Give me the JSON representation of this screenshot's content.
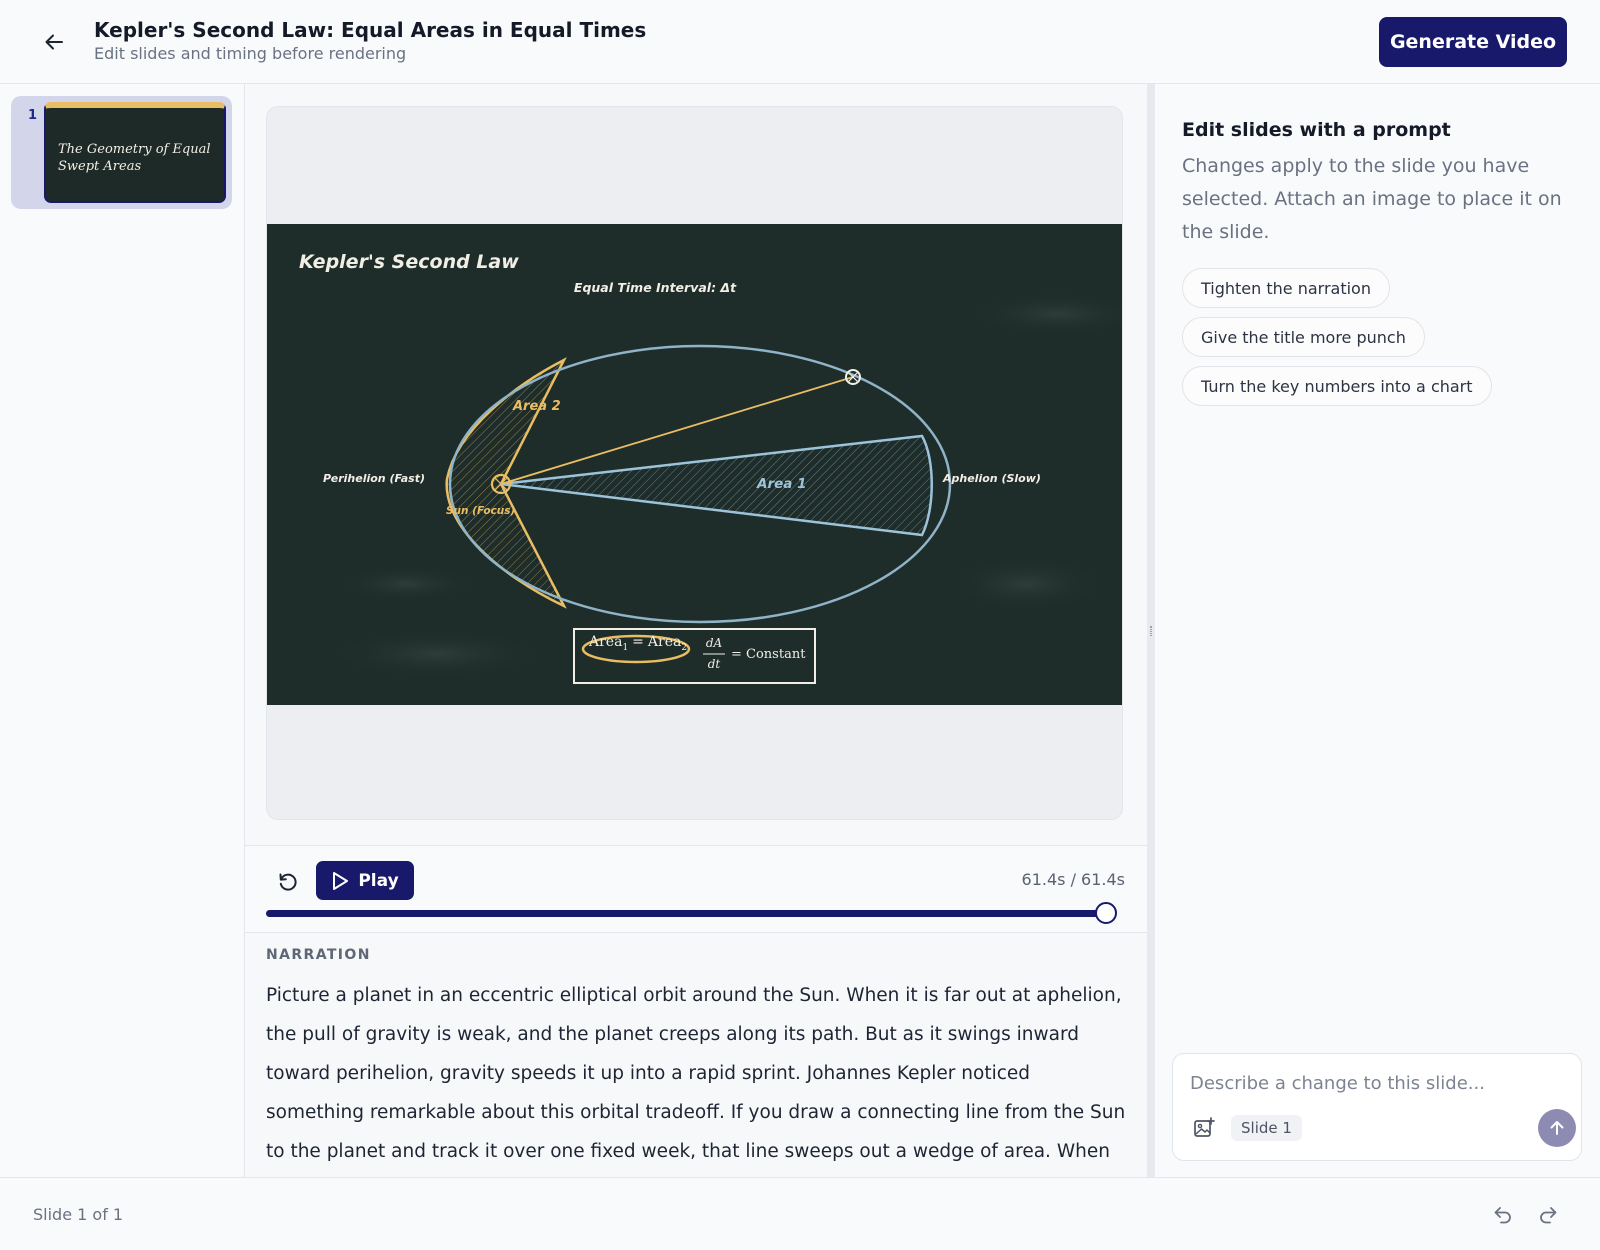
{
  "header": {
    "title": "Kepler's Second Law: Equal Areas in Equal Times",
    "subtitle": "Edit slides and timing before rendering",
    "generate_label": "Generate Video",
    "back_icon": "arrow-left-icon"
  },
  "slides": [
    {
      "number": "1",
      "thumb_title": "The Geometry of Equal Swept Areas",
      "selected": true
    }
  ],
  "slide_canvas": {
    "title": "Kepler's Second Law",
    "interval_label": "Equal Time Interval: Δt",
    "area2_label": "Area 2",
    "area1_label": "Area 1",
    "perihelion_label": "Perihelion (Fast)",
    "aphelion_label": "Aphelion (Slow)",
    "sun_label": "Sun (Focus)",
    "equation_left": "Area",
    "equation_sub1": "1",
    "equation_equals": "=",
    "equation_sub2": "2",
    "rate_num": "dA",
    "rate_den": "dt",
    "rate_rhs": "= Constant",
    "colors": {
      "board": "#1f2d2a",
      "chalk_gold": "#e9bd63",
      "chalk_blue": "#9dc3da",
      "chalk_white": "#f1eee5"
    }
  },
  "playback": {
    "play_label": "Play",
    "time_readout": "61.4s / 61.4s",
    "progress": 1.0,
    "restart_icon": "restart-icon",
    "play_icon": "play-icon"
  },
  "narration": {
    "label": "NARRATION",
    "text": "Picture a planet in an eccentric elliptical orbit around the Sun. When it is far out at aphelion, the pull of gravity is weak, and the planet creeps along its path. But as it swings inward toward perihelion, gravity speeds it up into a rapid sprint. Johannes Kepler noticed something remarkable about this orbital tradeoff. If you draw a connecting line from the Sun to the planet and track it over one fixed week, that line sweeps out a wedge of area. When the"
  },
  "assistant": {
    "title": "Edit slides with a prompt",
    "description": "Changes apply to the slide you have selected. Attach an image to place it on the slide.",
    "chips": [
      "Tighten the narration",
      "Give the title more punch",
      "Turn the key numbers into a chart"
    ],
    "input_placeholder": "Describe a change to this slide...",
    "input_value": "",
    "slide_pill": "Slide 1",
    "attach_icon": "image-add-icon",
    "send_icon": "arrow-up-icon"
  },
  "footer": {
    "slide_count": "Slide 1 of 1",
    "undo_icon": "undo-icon",
    "redo_icon": "redo-icon"
  }
}
